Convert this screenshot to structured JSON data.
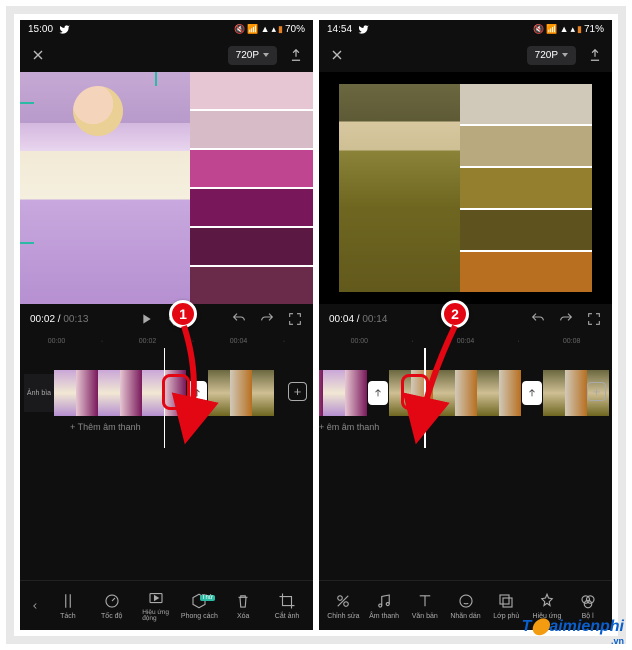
{
  "watermark": {
    "text": "aimienphi",
    "vn": ".vn"
  },
  "screens": [
    {
      "status": {
        "time": "15:00",
        "battery": "70%"
      },
      "resolution": "720P",
      "time": {
        "current": "00:02",
        "duration": "00:13"
      },
      "ruler": [
        "00:00",
        "00:02",
        "00:04"
      ],
      "palette": [
        "#e6c6d2",
        "#d7bcc8",
        "#c04590",
        "#78185a",
        "#5a1842",
        "#6a2a4a"
      ],
      "cover_label": "Ảnh bìa",
      "add_audio": "Thêm âm thanh",
      "badge": "1",
      "toolbar": [
        {
          "k": "tach",
          "label": "Tách"
        },
        {
          "k": "tocdo",
          "label": "Tốc độ"
        },
        {
          "k": "hieuung",
          "label": "Hiệu ứng\nđộng"
        },
        {
          "k": "phongcach",
          "label": "Phong cách",
          "tag": "Thử"
        },
        {
          "k": "xoa",
          "label": "Xóa"
        },
        {
          "k": "catanh",
          "label": "Cắt ảnh"
        }
      ]
    },
    {
      "status": {
        "time": "14:54",
        "battery": "71%"
      },
      "resolution": "720P",
      "time": {
        "current": "00:04",
        "duration": "00:14"
      },
      "ruler": [
        "00:00",
        "00:04",
        "00:08"
      ],
      "palette": [
        "#d0c9ba",
        "#b8a97e",
        "#937f2e",
        "#5e521e",
        "#b86f1f"
      ],
      "add_audio": "êm âm thanh",
      "badge": "2",
      "toolbar": [
        {
          "k": "chinhsua",
          "label": "Chỉnh sửa"
        },
        {
          "k": "amthanh",
          "label": "Âm thanh"
        },
        {
          "k": "vanban",
          "label": "Văn bản"
        },
        {
          "k": "nhandan",
          "label": "Nhãn dán"
        },
        {
          "k": "lopphu",
          "label": "Lớp phủ"
        },
        {
          "k": "hieuung2",
          "label": "Hiệu ứng"
        },
        {
          "k": "bol",
          "label": "Bộ l"
        }
      ]
    }
  ]
}
